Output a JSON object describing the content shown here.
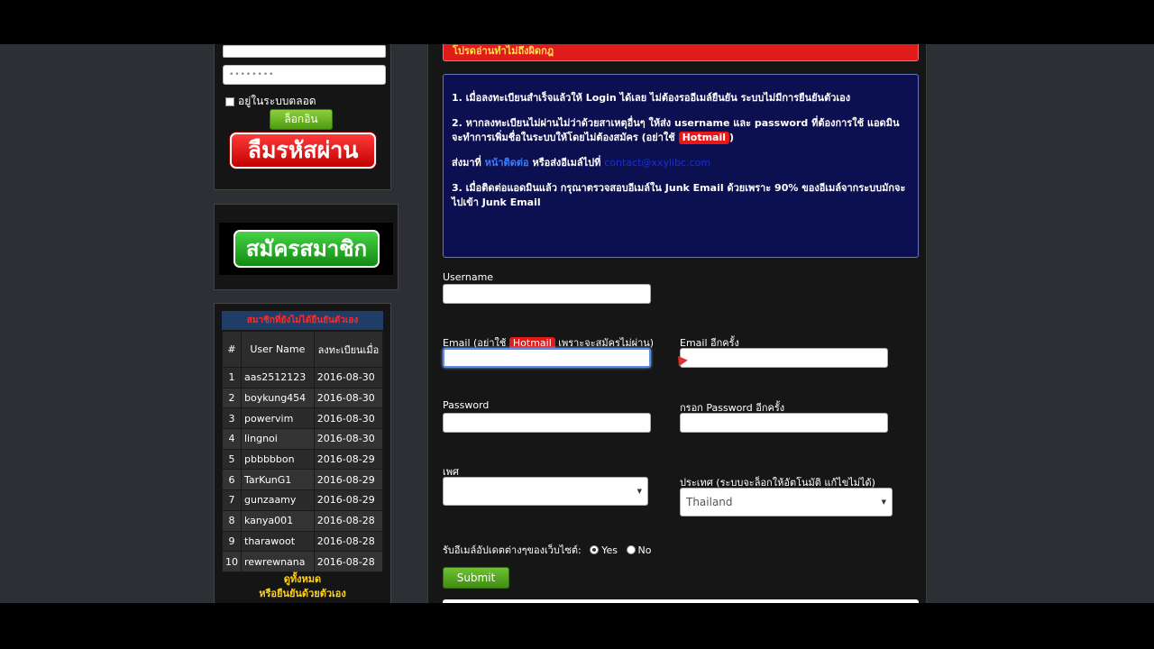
{
  "sidebar": {
    "password_mask": "••••••••",
    "remember_label": "อยู่ในระบบตลอด",
    "login_label": "ล็อกอิน",
    "forgot_label": "ลืมรหัสผ่าน",
    "register_label": "สมัครสมาชิก",
    "members_title": "สมาชิกที่ยังไม่ได้ยืนยันตัวเอง",
    "members_headers": [
      "#",
      "User Name",
      "ลงทะเบียนเมื่อ"
    ],
    "members": [
      {
        "num": "1",
        "user": "aas2512123",
        "date": "2016-08-30"
      },
      {
        "num": "2",
        "user": "boykung454",
        "date": "2016-08-30"
      },
      {
        "num": "3",
        "user": "powervim",
        "date": "2016-08-30"
      },
      {
        "num": "4",
        "user": "lingnoi",
        "date": "2016-08-30"
      },
      {
        "num": "5",
        "user": "pbbbbbon",
        "date": "2016-08-29"
      },
      {
        "num": "6",
        "user": "TarKunG1",
        "date": "2016-08-29"
      },
      {
        "num": "7",
        "user": "gunzaamy",
        "date": "2016-08-29"
      },
      {
        "num": "8",
        "user": "kanya001",
        "date": "2016-08-28"
      },
      {
        "num": "9",
        "user": "tharawoot",
        "date": "2016-08-28"
      },
      {
        "num": "10",
        "user": "rewrewnana",
        "date": "2016-08-28"
      }
    ],
    "view_all_line1": "ดูทั้งหมด",
    "view_all_line2": "หรือยืนยันด้วยตัวเอง"
  },
  "main": {
    "warning_text": "โปรดอ่านทำไม่ถึงผิดกฎ",
    "info": {
      "p1": "1. เมื่อลงทะเบียนสำเร็จแล้วให้ Login ได้เลย ไม่ต้องรออีเมล์ยืนยัน ระบบไม่มีการยืนยันตัวเอง",
      "p2_text": "2. หากลงทะเบียนไม่ผ่านไม่ว่าด้วยสาเหตุอื่นๆ ให้ส่ง username และ password ที่ต้องการใช้ แอดมินจะทำการเพิ่มชื่อในระบบให้โดยไม่ต้องสมัคร (อย่าใช้",
      "hotmail": "Hotmail",
      "p2_end": ")",
      "send_prefix": "ส่งมาที่",
      "contact_link": "หน้าติดต่อ",
      "send_mid": "หรือส่งอีเมล์ไปที่",
      "email_link": "contact@xxylibc.com",
      "p3": "3. เมื่อติดต่อแอดมินแล้ว กรุณาตรวจสอบอีเมล์ใน Junk Email ด้วยเพราะ 90% ของอีเมล์จากระบบมักจะไปเข้า Junk Email"
    },
    "form": {
      "username_label": "Username",
      "email_label_prefix": "Email (อย่าใช้",
      "email_label_hot": "Hotmail",
      "email_label_suffix": "เพราะจะสมัครไม่ผ่าน)",
      "email_confirm_label": "Email อีกครั้ง",
      "password_label": "Password",
      "password_confirm_label": "กรอก Password อีกครั้ง",
      "gender_label": "เพศ",
      "country_label": "ประเทศ (ระบบจะล็อกให้อัตโนมัติ แก้ไขไม่ได้)",
      "country_value": "Thailand",
      "newsletter_label": "รับอีเมล์อัปเดตต่างๆของเว็บไซต์:",
      "yes_label": "Yes",
      "no_label": "No",
      "submit_label": "Submit"
    }
  }
}
